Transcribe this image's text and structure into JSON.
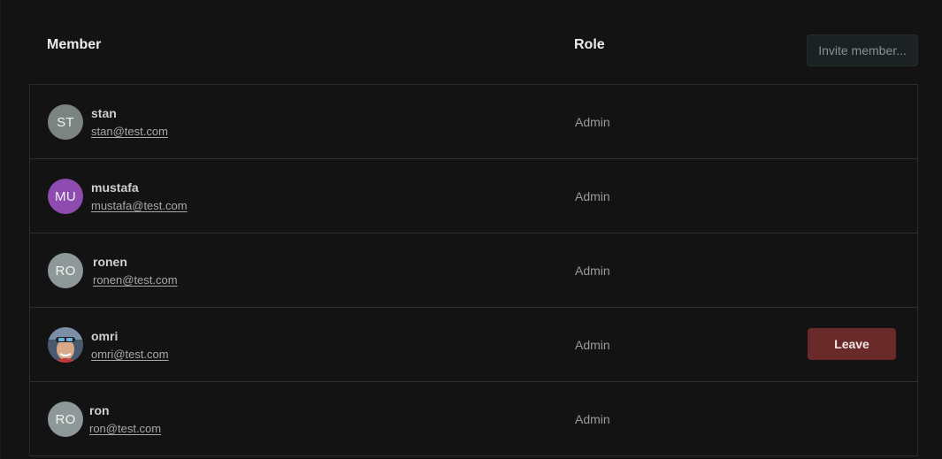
{
  "header": {
    "member_label": "Member",
    "role_label": "Role",
    "invite_label": "Invite member..."
  },
  "members": [
    {
      "initials": "ST",
      "name": "stan",
      "email": "stan@test.com",
      "role": "Admin",
      "avatar_color": "#7c8482"
    },
    {
      "initials": "MU",
      "name": "mustafa",
      "email": "mustafa@test.com",
      "role": "Admin",
      "avatar_color": "#8e4bb0"
    },
    {
      "initials": "RO",
      "name": "ronen",
      "email": "ronen@test.com",
      "role": "Admin",
      "avatar_color": "#8f9898"
    },
    {
      "initials": "",
      "name": "omri",
      "email": "omri@test.com",
      "role": "Admin",
      "avatar_color": "#3a4a5c",
      "photo": true,
      "action_label": "Leave"
    },
    {
      "initials": "RO",
      "name": "ron",
      "email": "ron@test.com",
      "role": "Admin",
      "avatar_color": "#8f9898"
    }
  ],
  "colors": {
    "background": "#131313",
    "leave_button": "#6a2a2a",
    "invite_button": "#1c2222"
  }
}
